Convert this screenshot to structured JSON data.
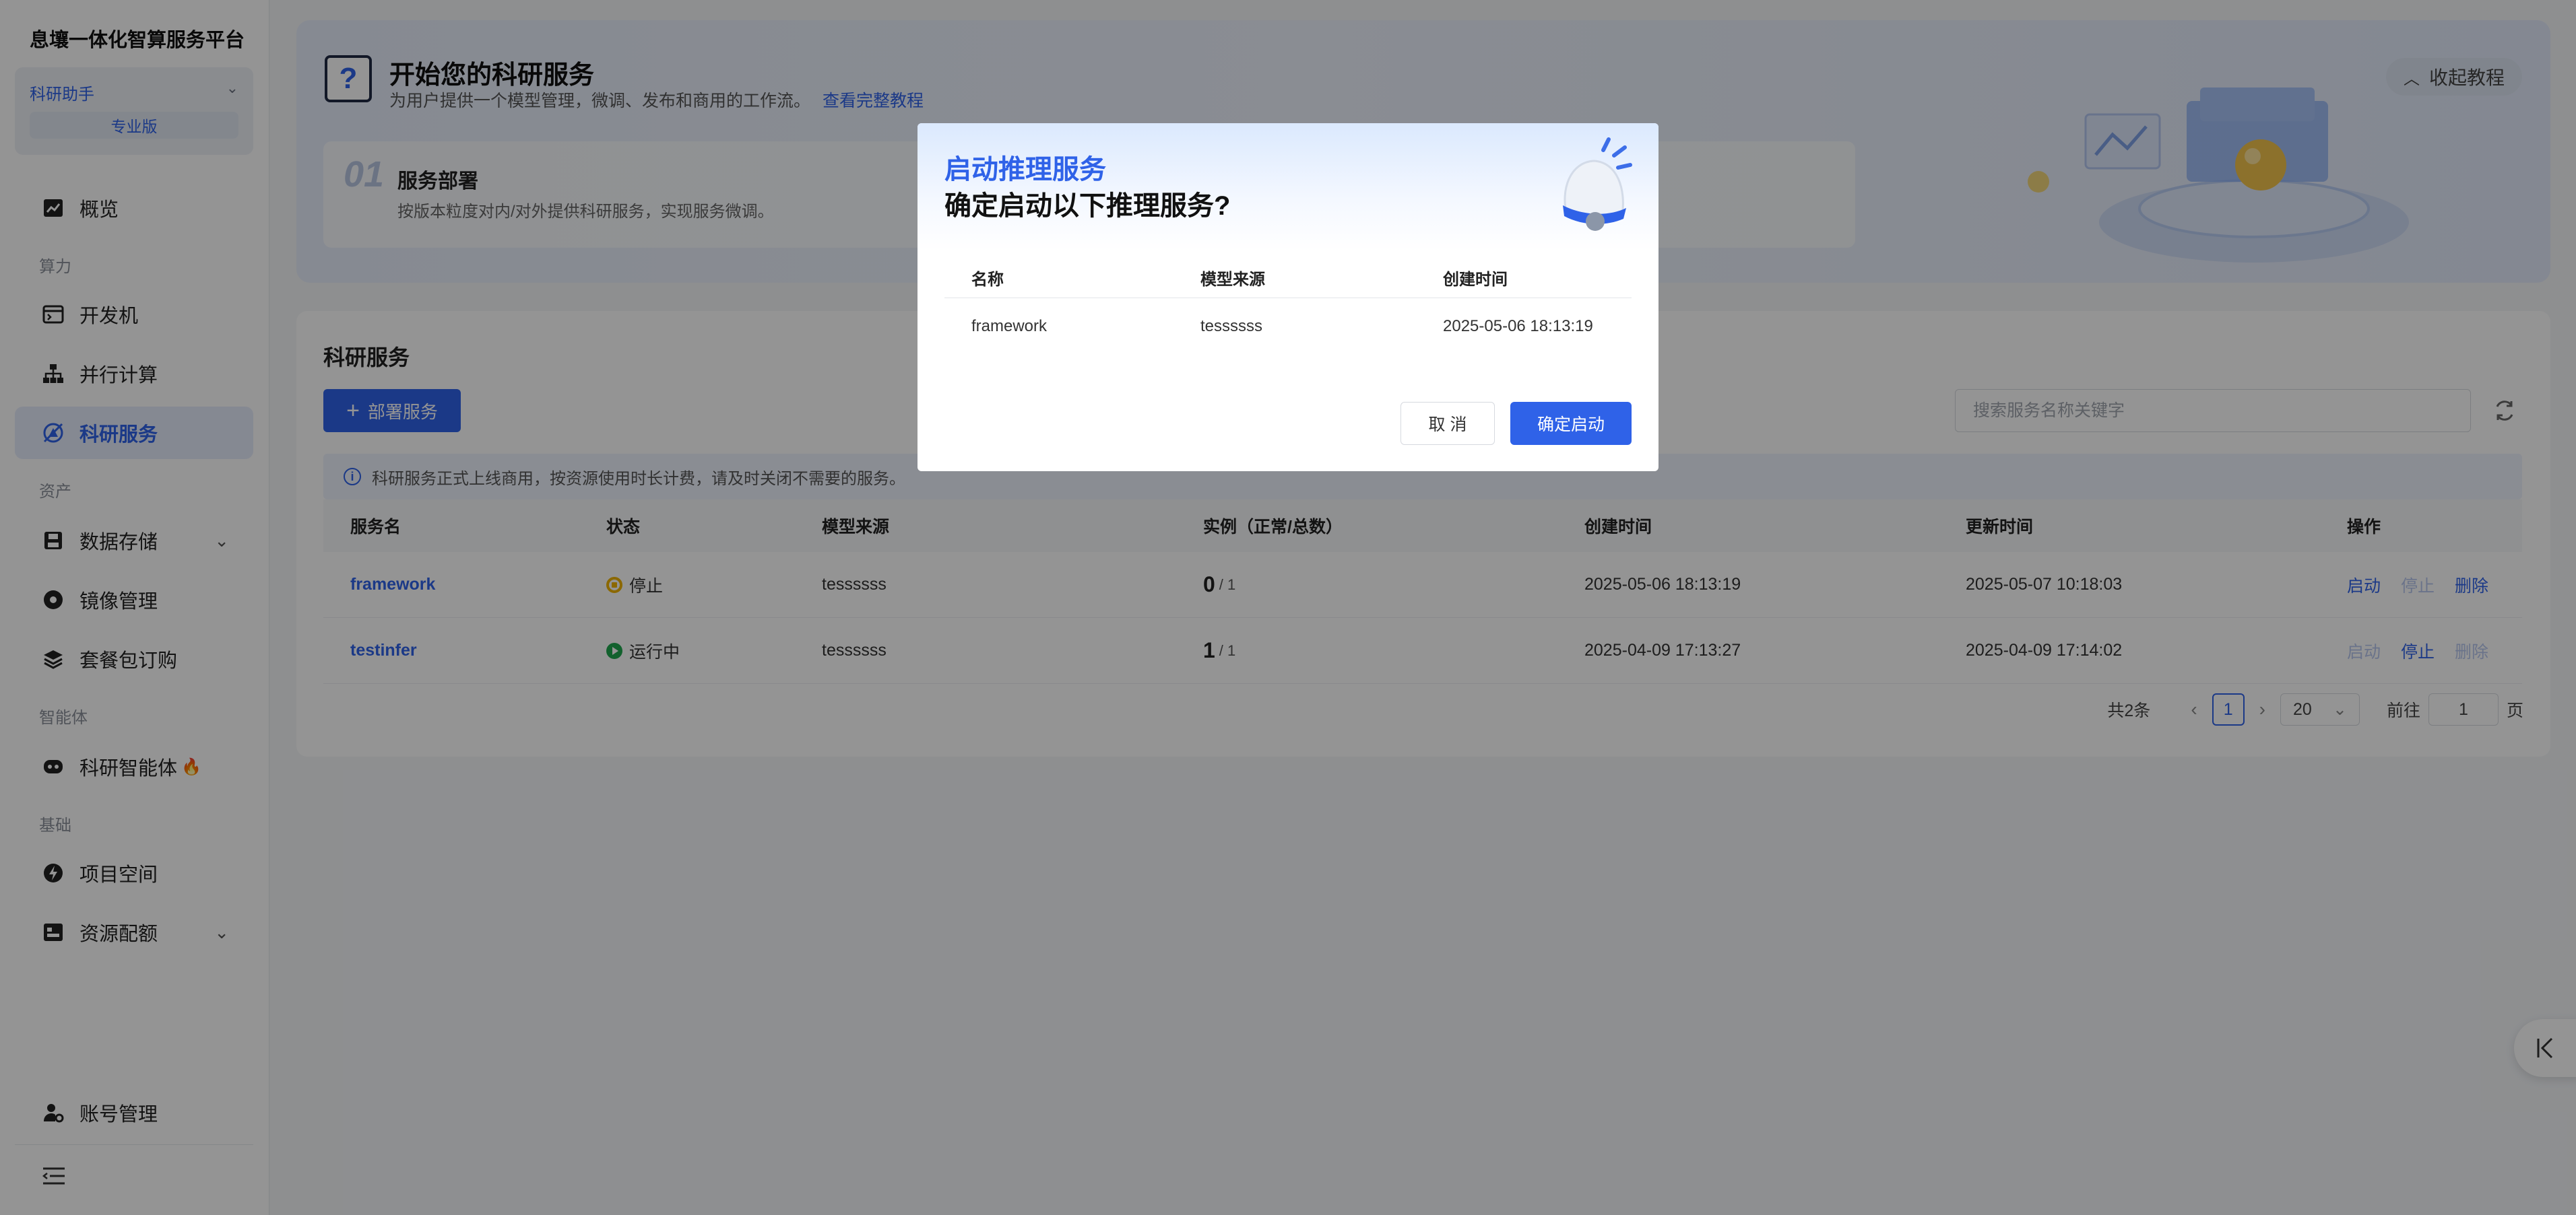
{
  "sidebar": {
    "brand": "息壤一体化智算服务平台",
    "assistant": {
      "label": "科研助手",
      "edition": "专业版"
    },
    "items": {
      "overview": "概览",
      "group_compute": "算力",
      "devmachine": "开发机",
      "parallel": "并行计算",
      "research": "科研服务",
      "group_assets": "资产",
      "storage": "数据存储",
      "images": "镜像管理",
      "packages": "套餐包订购",
      "group_agent": "智能体",
      "agent": "科研智能体",
      "group_basic": "基础",
      "project": "项目空间",
      "quota": "资源配额",
      "account": "账号管理"
    }
  },
  "banner": {
    "title": "开始您的科研服务",
    "subtitle": "为用户提供一个模型管理，微调、发布和商用的工作流。",
    "link": "查看完整教程",
    "card_num": "01",
    "card_title": "服务部署",
    "card_desc": "按版本粒度对内/对外提供科研服务，实现服务微调。",
    "collapse": "收起教程"
  },
  "panel": {
    "title": "科研服务",
    "deploy_label": "部署服务",
    "search_placeholder": "搜索服务名称关键字",
    "notice": "科研服务正式上线商用，按资源使用时长计费，请及时关闭不需要的服务。",
    "columns": [
      "服务名",
      "状态",
      "模型来源",
      "实例（正常/总数）",
      "创建时间",
      "更新时间",
      "操作"
    ],
    "rows": [
      {
        "name": "framework",
        "status": "停止",
        "source": "tessssss",
        "inst_ok": "0",
        "inst_total": "/ 1",
        "created": "2025-05-06 18:13:19",
        "updated": "2025-05-07 10:18:03",
        "op_start": "启动",
        "op_stop": "停止",
        "op_delete": "删除"
      },
      {
        "name": "testinfer",
        "status": "运行中",
        "source": "tessssss",
        "inst_ok": "1",
        "inst_total": "/ 1",
        "created": "2025-04-09 17:13:27",
        "updated": "2025-04-09 17:14:02",
        "op_start": "启动",
        "op_stop": "停止",
        "op_delete": "删除"
      }
    ],
    "pagination": {
      "total": "共2条",
      "page": "1",
      "size": "20",
      "goto": "前往",
      "goto_value": "1",
      "page_unit": "页"
    }
  },
  "modal": {
    "title": "启动推理服务",
    "question": "确定启动以下推理服务?",
    "columns": [
      "名称",
      "模型来源",
      "创建时间"
    ],
    "row": {
      "name": "framework",
      "source": "tessssss",
      "created": "2025-05-06 18:13:19"
    },
    "cancel": "取 消",
    "confirm": "确定启动"
  },
  "colors": {
    "accent": "#2f62e8",
    "stop": "#f0b400",
    "running": "#1fa84f"
  }
}
